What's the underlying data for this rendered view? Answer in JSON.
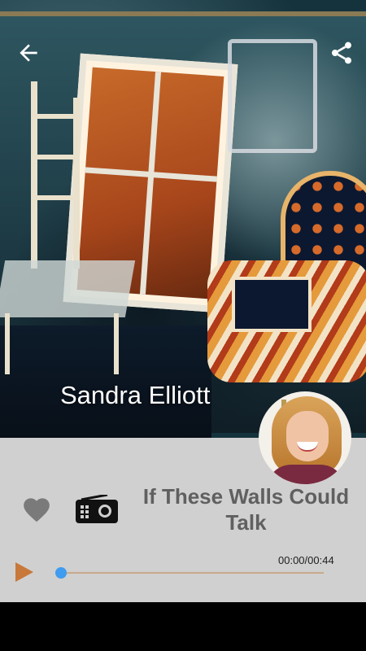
{
  "artist": {
    "name": "Sandra Elliott"
  },
  "track": {
    "title": "If These Walls Could Talk",
    "time": "00:00/00:44",
    "progress": 0
  },
  "icons": {
    "back": "arrow-back-icon",
    "share": "share-icon",
    "favorite": "heart-icon",
    "radio": "radio-icon",
    "play": "play-icon"
  },
  "colors": {
    "panel": "#d0d0d0",
    "title": "#606060",
    "play": "#c8783a",
    "seek_knob": "#3f9cf0",
    "seek_line": "#c9a98a"
  }
}
